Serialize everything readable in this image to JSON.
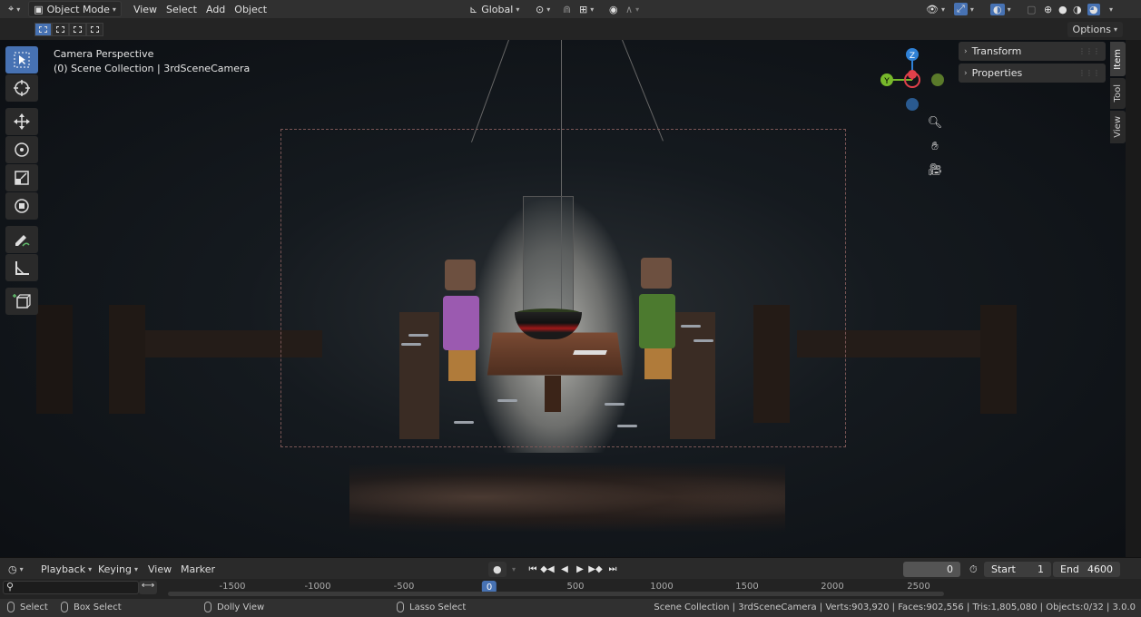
{
  "header": {
    "editor_type_icon": "3d-viewport-icon",
    "mode": "Object Mode",
    "menus": [
      "View",
      "Select",
      "Add",
      "Object"
    ],
    "orientation": "Global",
    "options_label": "Options"
  },
  "viewport": {
    "view_name": "Camera Perspective",
    "collection_info": "(0) Scene Collection | 3rdSceneCamera",
    "gizmo_axes": [
      "Z",
      "Y"
    ]
  },
  "npanel": {
    "panels": [
      "Transform",
      "Properties"
    ],
    "tabs": [
      "Item",
      "Tool",
      "View"
    ]
  },
  "timeline": {
    "menus": [
      "Playback",
      "Keying",
      "View",
      "Marker"
    ],
    "current_frame": "0",
    "start_label": "Start",
    "start_value": "1",
    "end_label": "End",
    "end_value": "4600",
    "ticks": [
      "-1500",
      "-1000",
      "-500",
      "0",
      "500",
      "1000",
      "1500",
      "2000",
      "2500"
    ]
  },
  "statusbar": {
    "select": "Select",
    "box_select": "Box Select",
    "dolly_view": "Dolly View",
    "lasso_select": "Lasso Select",
    "stats": "Scene Collection | 3rdSceneCamera | Verts:903,920 | Faces:902,556 | Tris:1,805,080 | Objects:0/32 | 3.0.0"
  },
  "colors": {
    "accent": "#4772b3",
    "axis_x": "#e0404a",
    "axis_y": "#77b82b",
    "axis_z": "#2f81d6"
  }
}
